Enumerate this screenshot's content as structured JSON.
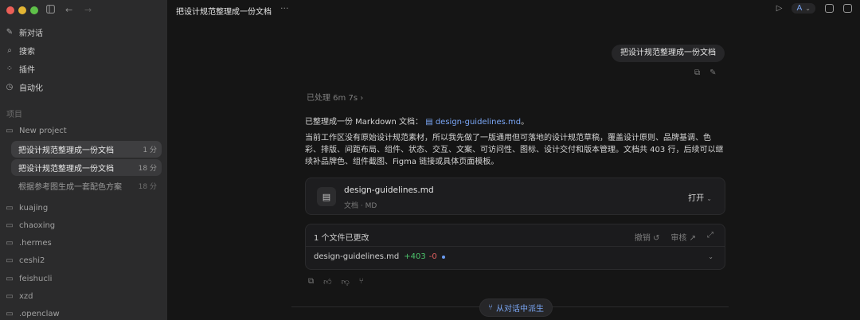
{
  "window": {
    "title": "把设计规范整理成一份文档"
  },
  "sidebar": {
    "nav": [
      {
        "label": "新对话",
        "icon": "edit-icon"
      },
      {
        "label": "搜索",
        "icon": "search-icon"
      },
      {
        "label": "插件",
        "icon": "plugins-icon"
      },
      {
        "label": "自动化",
        "icon": "clock-icon"
      }
    ],
    "section_label": "项目",
    "project": "New project",
    "threads": [
      {
        "title": "把设计规范整理成一份文档",
        "time": "1 分"
      },
      {
        "title": "把设计规范整理成一份文档",
        "time": "18 分"
      },
      {
        "title": "根据参考图生成一套配色方案",
        "time": "18 分"
      }
    ],
    "folders": [
      "kuajing",
      "chaoxing",
      ".hermes",
      "ceshi2",
      "feishucli",
      "xzd",
      ".openclaw"
    ]
  },
  "topbar": {
    "more": "···",
    "agent_badge": "A"
  },
  "chat": {
    "user_message": "把设计规范整理成一份文档",
    "processed": "已处理 6m 7s",
    "summary_prefix": "已整理成一份 Markdown 文档：",
    "summary_link": "design-guidelines.md",
    "summary_suffix": "。",
    "body": "当前工作区没有原始设计规范素材，所以我先做了一版通用但可落地的设计规范草稿，覆盖设计原则、品牌基调、色彩、排版、间距布局、组件、状态、交互、文案、可访问性、图标、设计交付和版本管理。文档共 403 行，后续可以继续补品牌色、组件截图、Figma 链接或具体页面模板。",
    "file_card": {
      "name": "design-guidelines.md",
      "meta": "文档 · MD",
      "open_label": "打开"
    },
    "changes": {
      "header": "1 个文件已更改",
      "undo_label": "撤销",
      "review_label": "审核",
      "file": "design-guidelines.md",
      "additions": "+403",
      "deletions": "-0"
    },
    "fork_label": "从对话中派生"
  },
  "colors": {
    "accent": "#7aa6f5",
    "add": "#4cc26b",
    "del": "#e06060",
    "sidebar_bg": "#2b2b2c",
    "main_bg": "#151515"
  }
}
